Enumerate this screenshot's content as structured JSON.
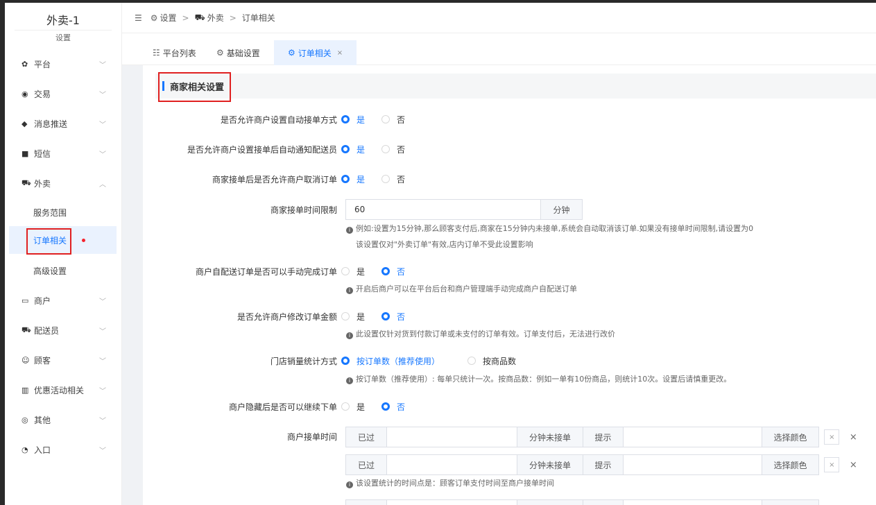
{
  "sidebar": {
    "brand": "外卖-1",
    "brand_sub": "设置",
    "items": [
      {
        "icon": "gear-icon",
        "glyph": "✿",
        "label": "平台"
      },
      {
        "icon": "transaction-icon",
        "glyph": "◉",
        "label": "交易"
      },
      {
        "icon": "push-icon",
        "glyph": "◆",
        "label": "消息推送"
      },
      {
        "icon": "sms-icon",
        "glyph": "■",
        "label": "短信"
      },
      {
        "icon": "delivery-icon",
        "glyph": "⛟",
        "label": "外卖"
      }
    ],
    "sub_items": [
      "服务范围",
      "订单相关",
      "高级设置"
    ],
    "items2": [
      {
        "icon": "shop-icon",
        "glyph": "▭",
        "label": "商户"
      },
      {
        "icon": "courier-icon",
        "glyph": "⛟",
        "label": "配送员"
      },
      {
        "icon": "customer-icon",
        "glyph": "☺",
        "label": "顾客"
      },
      {
        "icon": "gift-icon",
        "glyph": "▥",
        "label": "优惠活动相关"
      },
      {
        "icon": "other-icon",
        "glyph": "◎",
        "label": "其他"
      },
      {
        "icon": "entry-icon",
        "glyph": "◔",
        "label": "入口"
      }
    ]
  },
  "breadcrumb": {
    "collapse": "☰",
    "b1": "设置",
    "b2": "外卖",
    "b3": "订单相关",
    "sep": ">"
  },
  "tabs": {
    "t1": "平台列表",
    "t2": "基础设置",
    "t3": "订单相关",
    "close": "×"
  },
  "section": {
    "title": "商家相关设置"
  },
  "form": {
    "auto_accept": {
      "label": "是否允许商户设置自动接单方式",
      "yes": "是",
      "no": "否",
      "value": "是"
    },
    "auto_notify": {
      "label": "是否允许商户设置接单后自动通知配送员",
      "yes": "是",
      "no": "否",
      "value": "是"
    },
    "cancel_after": {
      "label": "商家接单后是否允许商户取消订单",
      "yes": "是",
      "no": "否",
      "value": "是"
    },
    "time_limit": {
      "label": "商家接单时间限制",
      "value": "60",
      "unit": "分钟",
      "hint1": "例如:设置为15分钟,那么顾客支付后,商家在15分钟内未接单,系统会自动取消该订单.如果没有接单时间限制,请设置为0",
      "hint2": "该设置仅对\"外卖订单\"有效,店内订单不受此设置影响"
    },
    "self_deliver": {
      "label": "商户自配送订单是否可以手动完成订单",
      "yes": "是",
      "no": "否",
      "value": "否",
      "hint": "开启后商户可以在平台后台和商户管理端手动完成商户自配送订单"
    },
    "modify_amount": {
      "label": "是否允许商户修改订单金额",
      "yes": "是",
      "no": "否",
      "value": "否",
      "hint": "此设置仅针对货到付款订单或未支付的订单有效。订单支付后，无法进行改价"
    },
    "sales_stat": {
      "label": "门店销量统计方式",
      "opt1": "按订单数（推荐使用）",
      "opt2": "按商品数",
      "value": "按订单数（推荐使用）",
      "hint": "按订单数（推荐使用）: 每单只统计一次。按商品数：例如一单有10份商品，则统计10次。设置后请慎重更改。"
    },
    "hidden_order": {
      "label": "商户隐藏后是否可以继续下单",
      "yes": "是",
      "no": "否",
      "value": "否"
    },
    "accept_time": {
      "label": "商户接单时间",
      "rows": [
        {
          "prefix": "已过",
          "value": "",
          "suffix": "分钟未接单",
          "tip": "提示",
          "tip_value": "",
          "color": "选择颜色",
          "clear": "×",
          "remove": "×"
        },
        {
          "prefix": "已过",
          "value": "",
          "suffix": "分钟未接单",
          "tip": "提示",
          "tip_value": "",
          "color": "选择颜色",
          "clear": "×",
          "remove": "×"
        }
      ],
      "hint": "该设置统计的时间点是：顾客订单支付时间至商户接单时间"
    },
    "info_glyph": "i"
  }
}
